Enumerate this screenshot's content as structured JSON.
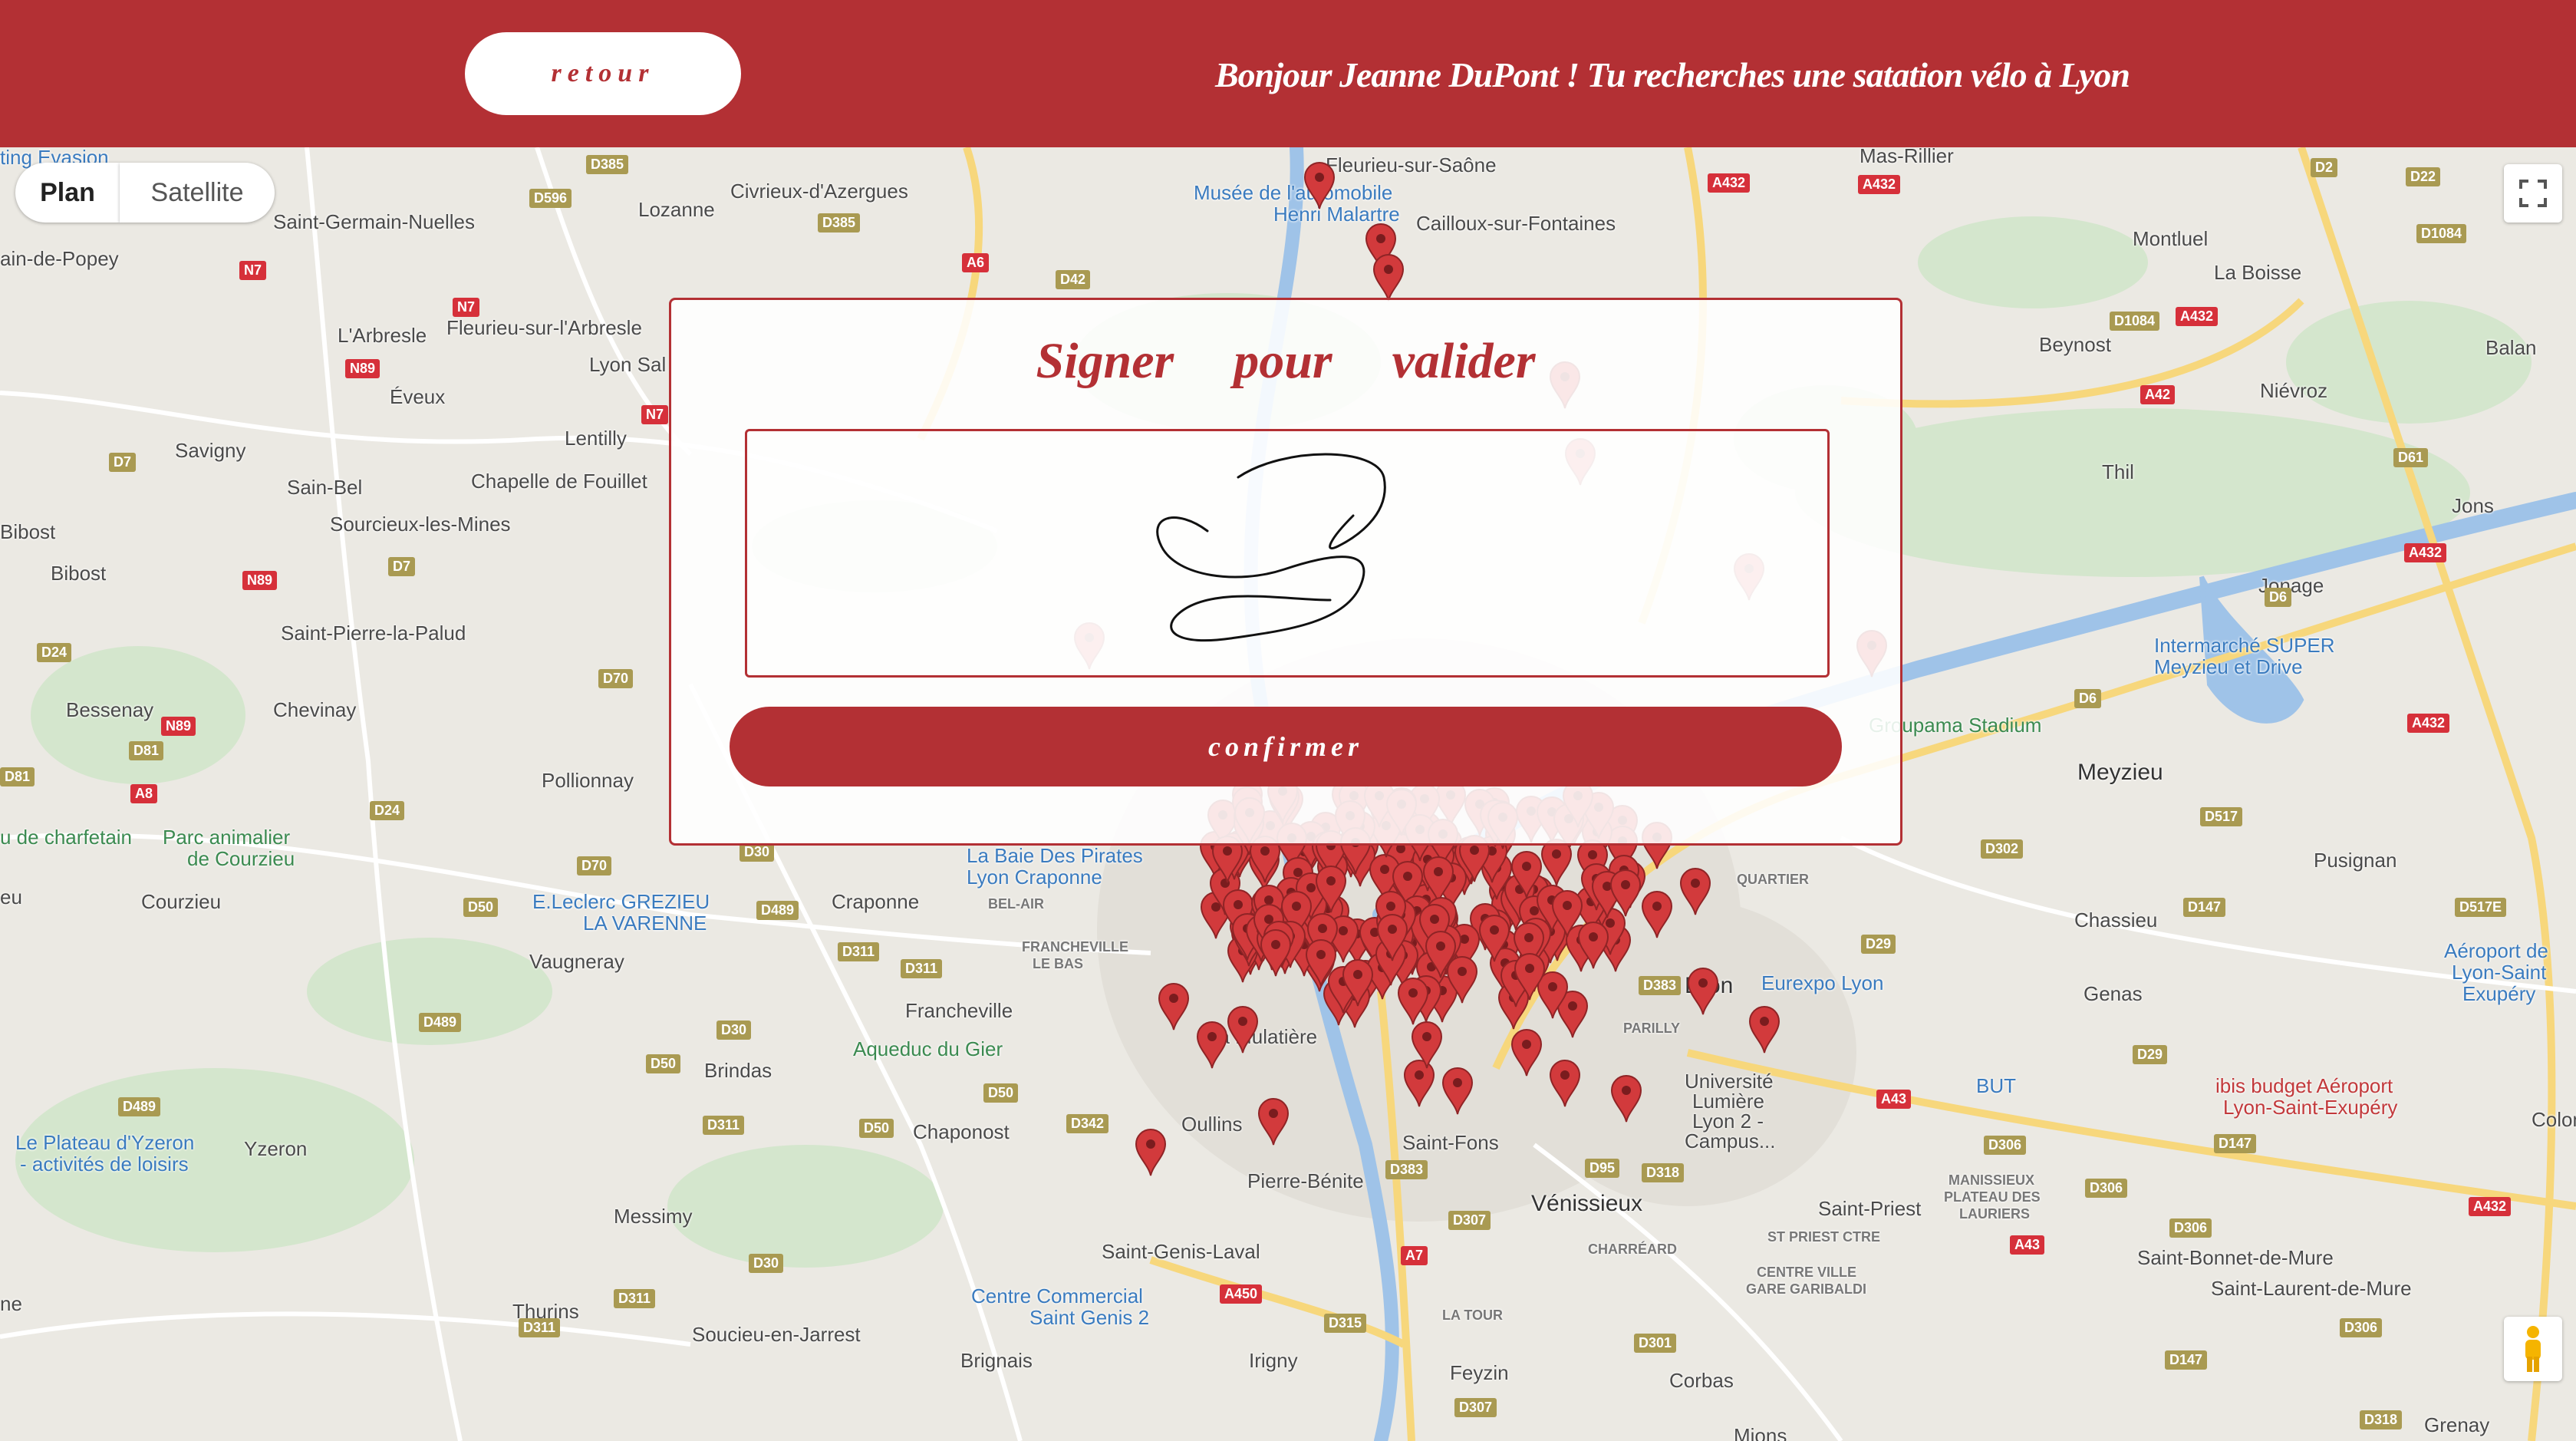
{
  "header": {
    "back_label": "retour",
    "greeting": "Bonjour Jeanne DuPont ! Tu recherches une satation vélo à Lyon"
  },
  "map": {
    "type_plan": "Plan",
    "type_satellite": "Satellite",
    "places": {
      "fleurieu_saone": "Fleurieu-sur-Saône",
      "mas_rillier": "Mas-Rillier",
      "musee_auto": "Musée de l'automobile",
      "henri_malartre": "Henri Malartre",
      "cailloux": "Cailloux-sur-Fontaines",
      "montluel": "Montluel",
      "la_boisse": "La Boisse",
      "beynost": "Beynost",
      "balan": "Balan",
      "nievroz": "Niévroz",
      "thil": "Thil",
      "jons": "Jons",
      "jonage": "Jonage",
      "intermarche": "Intermarché SUPER",
      "intermarche2": "Meyzieu et Drive",
      "groupama": "Groupama Stadium",
      "meyzieu": "Meyzieu",
      "pusignan": "Pusignan",
      "chassieu": "Chassieu",
      "genas": "Genas",
      "aeroport": "Aéroport de",
      "aeroport2": "Lyon-Saint",
      "aeroport3": "Exupéry",
      "eurexpo": "Eurexpo Lyon",
      "ibis": "ibis budget Aéroport",
      "ibis2": "Lyon-Saint-Exupéry",
      "but": "BUT",
      "univ": "Université",
      "univ2": "Lumière",
      "univ3": "Lyon 2 -",
      "univ4": "Campus...",
      "bron": "Bron",
      "venissieux": "Vénissieux",
      "saint_priest": "Saint-Priest",
      "saint_bonnet": "Saint-Bonnet-de-Mure",
      "saint_laurent": "Saint-Laurent-de-Mure",
      "corbas": "Corbas",
      "feyzin": "Feyzin",
      "mions": "Mions",
      "grenay": "Grenay",
      "colomb": "Colomb",
      "saint_fons": "Saint-Fons",
      "pierre_benite": "Pierre-Bénite",
      "oullins": "Oullins",
      "la_mulatiere": "La Mulatière",
      "saint_genis_laval": "Saint-Genis-Laval",
      "centre_commercial": "Centre Commercial",
      "saint_genis_2": "Saint Genis 2",
      "brignais": "Brignais",
      "irigny": "Irigny",
      "soucieu": "Soucieu-en-Jarrest",
      "thurins": "Thurins",
      "messimy": "Messimy",
      "chaponost": "Chaponost",
      "brindas": "Brindas",
      "aqueduc": "Aqueduc du Gier",
      "francheville": "Francheville",
      "craponne": "Craponne",
      "baie_pirates": "La Baie Des Pirates",
      "baie_pirates2": "Lyon Craponne",
      "leclerc": "E.Leclerc GREZIEU",
      "leclerc2": "LA VARENNE",
      "vaugneray": "Vaugneray",
      "yzeron": "Yzeron",
      "plateau_yzeron": "Le Plateau d'Yzeron",
      "plateau_yzeron2": "- activités de loisirs",
      "courzieu": "Courzieu",
      "parc_animalier": "Parc animalier",
      "parc_animalier2": "de Courzieu",
      "pollionnay": "Pollionnay",
      "charfetain": "u de charfetain",
      "bessenay": "Bessenay",
      "chevinay": "Chevinay",
      "saint_pierre_palud": "Saint-Pierre-la-Palud",
      "bibost": "Bibost",
      "bibost2": "Bibost",
      "savigny": "Savigny",
      "sain_bel": "Sain-Bel",
      "sourcieux": "Sourcieux-les-Mines",
      "chapelle": "Chapelle de Fouillet",
      "eveux": "Éveux",
      "lentilly": "Lentilly",
      "larbresle": "L'Arbresle",
      "fleurieu_arbresle": "Fleurieu-sur-l'Arbresle",
      "saint_germain": "Saint-Germain-Nuelles",
      "popey": "ain-de-Popey",
      "lozanne": "Lozanne",
      "civrieux": "Civrieux-d'Azergues",
      "lyon_sal": "Lyon Sal",
      "ting_evasion": "ting Evasion",
      "messimy_ne": "ne",
      "bel_air": "BEL-AIR",
      "francheville_bas": "FRANCHEVILLE",
      "francheville_bas2": "LE BAS",
      "quartier": "QUARTIER",
      "parilly": "PARILLY",
      "manissieux": "MANISSIEUX",
      "manissieux2": "PLATEAU DES",
      "manissieux3": "LAURIERS",
      "st_priest_ctre": "ST PRIEST CTRE",
      "centre_ville": "CENTRE VILLE",
      "centre_ville2": "GARE GARIBALDI",
      "charreard": "CHARRÉARD",
      "la_tour": "LA TOUR",
      "eu": "eu"
    },
    "roads": {
      "d385": "D385",
      "d596": "D596",
      "d385b": "D385",
      "n7": "N7",
      "n7b": "N7",
      "n7c": "N7",
      "a6": "A6",
      "d42": "D42",
      "a432": "A432",
      "a432b": "A432",
      "d2": "D2",
      "d22": "D22",
      "d1084": "D1084",
      "d1084b": "D1084",
      "a432c": "A432",
      "a42": "A42",
      "d61": "D61",
      "a432d": "A432",
      "d6": "D6",
      "d6b": "D6",
      "a432e": "A432",
      "d517": "D517",
      "d302": "D302",
      "d147": "D147",
      "d517e": "D517E",
      "d29": "D29",
      "d29b": "D29",
      "a43": "A43",
      "d147b": "D147",
      "d306": "D306",
      "d306b": "D306",
      "d306c": "D306",
      "a43b": "A43",
      "a432f": "A432",
      "d306d": "D306",
      "d147c": "D147",
      "d318": "D318",
      "d318b": "D318",
      "d383": "D383",
      "d383b": "D383",
      "d95": "D95",
      "d307": "D307",
      "a7": "A7",
      "d315": "D315",
      "d301": "D301",
      "d307b": "D307",
      "a450": "A450",
      "d342": "D342",
      "d50": "D50",
      "d311": "D311",
      "d30": "D30",
      "d311b": "D311",
      "d311c": "D311",
      "d30b": "D30",
      "d50b": "D50",
      "d311d": "D311",
      "d489": "D489",
      "d489b": "D489",
      "d489c": "D489",
      "d30c": "D30",
      "d50c": "D50",
      "d70": "D70",
      "d70b": "D70",
      "d24": "D24",
      "d24b": "D24",
      "n89": "N89",
      "n89b": "N89",
      "d81": "D81",
      "d81b": "D81",
      "d7": "D7",
      "d7b": "D7",
      "n89c": "N89",
      "a8": "A8",
      "d311e": "D311",
      "d50d": "D50"
    }
  },
  "modal": {
    "title_word1": "Signer",
    "title_word2": "pour",
    "title_word3": "valider",
    "confirm_label": "confirmer"
  },
  "colors": {
    "brand_red": "#b33034",
    "marker_red": "#d23a3c",
    "water_blue": "#9fc3e8",
    "road_yellow": "#f7d77c",
    "green": "#c6e3c0"
  },
  "icons": {
    "fullscreen": "fullscreen-icon",
    "pegman": "pegman-icon",
    "marker": "map-marker-icon"
  }
}
